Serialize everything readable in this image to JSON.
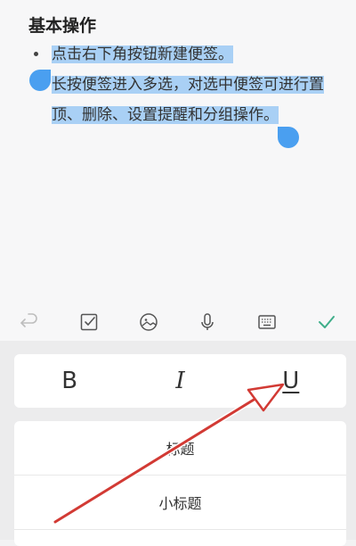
{
  "note": {
    "heading": "基本操作",
    "line1": "点击右下角按钮新建便签。",
    "line2": "长按便签进入多选，对选中便签可进行置顶、删除、设置提醒和分组操作。"
  },
  "toolbar": {
    "icons": [
      "undo-icon",
      "checklist-icon",
      "image-icon",
      "microphone-icon",
      "keyboard-icon",
      "checkmark-icon"
    ],
    "accent": "#3fae8a"
  },
  "format": {
    "bold_label": "B",
    "italic_label": "I",
    "underline_label": "U"
  },
  "headings": {
    "title_label": "标题",
    "subtitle_label": "小标题"
  },
  "colors": {
    "selection": "#a9d0f5",
    "handle": "#4a9ff0",
    "annotation_arrow": "#d23a34"
  }
}
